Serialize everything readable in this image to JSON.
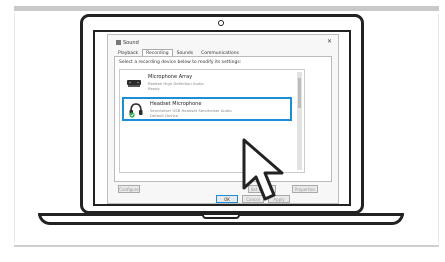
{
  "dialog": {
    "title": "Sound",
    "close_glyph": "✕"
  },
  "tabs": [
    {
      "label": "Playback"
    },
    {
      "label": "Recording"
    },
    {
      "label": "Sounds"
    },
    {
      "label": "Communications"
    }
  ],
  "instruction": "Select a recording device below to modify its settings:",
  "devices": [
    {
      "name": "Microphone Array",
      "line1": "Realtek High Definition Audio",
      "line2": "Ready",
      "icon": "microphone-array-icon",
      "selected": false
    },
    {
      "name": "Headset Microphone",
      "line1": "Sennheiser USB Headset      Sennheiser Audio",
      "line2": "Default Device",
      "icon": "headset-icon",
      "selected": true,
      "status_icon": "green-check-icon"
    }
  ],
  "buttons": {
    "configure": "Configure",
    "set_default": "Set Default",
    "properties": "Properties",
    "ok": "OK",
    "cancel": "Cancel",
    "apply": "Apply"
  },
  "colors": {
    "selection_border": "#1c8dd8",
    "default_check": "#2fa84f"
  }
}
